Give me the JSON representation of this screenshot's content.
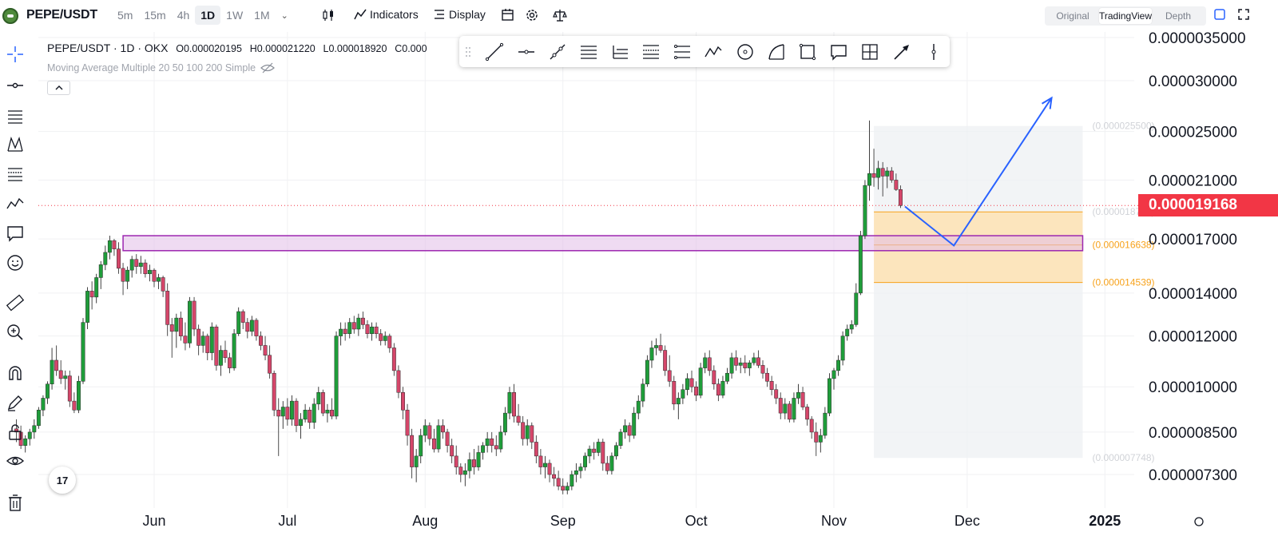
{
  "header": {
    "symbol": "PEPE/USDT",
    "intervals": [
      "5m",
      "15m",
      "4h",
      "1D",
      "1W",
      "1M"
    ],
    "active_interval": "1D",
    "indicators_label": "Indicators",
    "display_label": "Display",
    "view_modes": [
      "Original",
      "TradingView",
      "Depth"
    ],
    "active_view": "TradingView"
  },
  "legend": {
    "pair": "PEPE/USDT · 1D · OKX",
    "open": "O0.000020195",
    "high": "H0.000021220",
    "low": "L0.000018920",
    "close": "C0.000",
    "ma_label": "Moving Average Multiple 20 50 100 200 Simple"
  },
  "last_price": "0.000019168",
  "tv_logo": "17",
  "colors": {
    "up": "#26a69a",
    "up_candle": "#1f9d3a",
    "down": "#c2185b",
    "down_candle": "#d5466a",
    "last_price_badge": "#f23645",
    "zone_purple": "#9c27b0",
    "fib_orange": "#f7a21b",
    "arrow_blue": "#2962ff"
  },
  "chart_data": {
    "type": "candlestick",
    "y_axis_labels": [
      "0.0000035000",
      "0.000030000",
      "0.000025000",
      "0.000021000",
      "0.000017000",
      "0.000014000",
      "0.000012000",
      "0.000010000",
      "0.000008500",
      "0.000007300"
    ],
    "y_axis_values": [
      3.5e-05,
      3e-05,
      2.5e-05,
      2.1e-05,
      1.7e-05,
      1.4e-05,
      1.2e-05,
      1e-05,
      8.5e-06,
      7.3e-06
    ],
    "x_axis_labels": [
      "Jun",
      "Jul",
      "Aug",
      "Sep",
      "Oct",
      "Nov",
      "Dec",
      "2025"
    ],
    "x_axis_dates": [
      "2024-06-01",
      "2024-07-01",
      "2024-08-01",
      "2024-09-01",
      "2024-10-01",
      "2024-11-01",
      "2024-12-01",
      "2025-01-01"
    ],
    "candles": {
      "start_date": "2024-05-01",
      "interval": "1D",
      "ohlc": [
        [
          8.6,
          8.9,
          8.2,
          8.5
        ],
        [
          8.5,
          8.7,
          8.0,
          8.1
        ],
        [
          8.1,
          8.4,
          7.9,
          8.3
        ],
        [
          8.3,
          8.6,
          8.1,
          8.5
        ],
        [
          8.5,
          8.9,
          8.3,
          8.7
        ],
        [
          8.7,
          9.3,
          8.6,
          9.2
        ],
        [
          9.2,
          9.7,
          9.0,
          9.6
        ],
        [
          9.6,
          10.2,
          9.4,
          10.1
        ],
        [
          10.1,
          11.5,
          9.9,
          11.0
        ],
        [
          11.0,
          11.6,
          10.4,
          10.6
        ],
        [
          10.6,
          11.0,
          10.1,
          10.3
        ],
        [
          10.3,
          10.6,
          9.9,
          10.4
        ],
        [
          10.4,
          10.6,
          9.3,
          9.5
        ],
        [
          9.5,
          9.8,
          9.1,
          9.2
        ],
        [
          9.2,
          10.4,
          9.1,
          10.2
        ],
        [
          10.2,
          12.8,
          10.1,
          12.6
        ],
        [
          12.6,
          14.3,
          12.3,
          14.1
        ],
        [
          14.1,
          14.6,
          13.2,
          13.8
        ],
        [
          13.8,
          15.0,
          13.5,
          14.8
        ],
        [
          14.8,
          15.7,
          14.2,
          15.5
        ],
        [
          15.5,
          16.6,
          15.2,
          16.2
        ],
        [
          16.2,
          17.2,
          15.8,
          16.9
        ],
        [
          16.9,
          17.0,
          16.0,
          16.4
        ],
        [
          16.4,
          16.8,
          15.0,
          15.3
        ],
        [
          15.3,
          15.6,
          13.9,
          14.6
        ],
        [
          14.6,
          15.4,
          14.2,
          15.2
        ],
        [
          15.2,
          16.0,
          14.8,
          15.8
        ],
        [
          15.8,
          16.1,
          15.0,
          15.4
        ],
        [
          15.4,
          16.0,
          15.0,
          15.6
        ],
        [
          15.6,
          15.8,
          14.8,
          15.0
        ],
        [
          15.0,
          15.5,
          14.6,
          15.2
        ],
        [
          15.2,
          15.3,
          14.3,
          14.6
        ],
        [
          14.6,
          15.0,
          14.2,
          14.8
        ],
        [
          14.8,
          14.9,
          13.8,
          14.1
        ],
        [
          14.1,
          14.5,
          12.0,
          12.5
        ],
        [
          12.5,
          12.8,
          11.1,
          12.2
        ],
        [
          12.2,
          13.0,
          11.5,
          12.8
        ],
        [
          12.8,
          13.1,
          11.8,
          12.0
        ],
        [
          12.0,
          12.6,
          11.4,
          11.7
        ],
        [
          11.7,
          13.8,
          11.5,
          13.6
        ],
        [
          13.6,
          13.8,
          12.0,
          12.3
        ],
        [
          12.3,
          12.5,
          11.2,
          11.6
        ],
        [
          11.6,
          12.2,
          11.3,
          12.0
        ],
        [
          12.0,
          12.1,
          11.0,
          11.3
        ],
        [
          11.3,
          12.6,
          11.0,
          12.4
        ],
        [
          12.4,
          12.5,
          10.6,
          10.8
        ],
        [
          10.8,
          11.6,
          10.4,
          11.4
        ],
        [
          11.4,
          11.8,
          10.9,
          11.1
        ],
        [
          11.1,
          11.3,
          10.5,
          10.7
        ],
        [
          10.7,
          12.3,
          10.6,
          12.1
        ],
        [
          12.1,
          13.3,
          12.0,
          13.1
        ],
        [
          13.1,
          13.2,
          12.3,
          12.6
        ],
        [
          12.6,
          12.8,
          11.9,
          12.2
        ],
        [
          12.2,
          12.9,
          12.0,
          12.7
        ],
        [
          12.7,
          12.8,
          11.8,
          12.0
        ],
        [
          12.0,
          12.2,
          11.4,
          11.6
        ],
        [
          11.6,
          12.0,
          11.0,
          11.2
        ],
        [
          11.2,
          11.6,
          10.3,
          10.5
        ],
        [
          10.5,
          10.6,
          9.0,
          9.2
        ],
        [
          9.2,
          9.6,
          7.8,
          9.0
        ],
        [
          9.0,
          9.5,
          8.6,
          9.3
        ],
        [
          9.3,
          9.6,
          8.7,
          8.9
        ],
        [
          8.9,
          9.7,
          8.7,
          9.5
        ],
        [
          9.5,
          9.6,
          8.5,
          8.7
        ],
        [
          8.7,
          9.1,
          8.3,
          8.9
        ],
        [
          8.9,
          9.4,
          8.8,
          9.2
        ],
        [
          9.2,
          9.3,
          8.6,
          8.8
        ],
        [
          8.8,
          9.6,
          8.6,
          9.4
        ],
        [
          9.4,
          10.0,
          9.2,
          9.8
        ],
        [
          9.8,
          9.9,
          9.0,
          9.1
        ],
        [
          9.1,
          9.4,
          8.8,
          9.2
        ],
        [
          9.2,
          9.6,
          8.9,
          9.0
        ],
        [
          9.0,
          12.2,
          8.9,
          12.0
        ],
        [
          12.0,
          12.6,
          11.6,
          12.3
        ],
        [
          12.3,
          12.6,
          11.8,
          12.1
        ],
        [
          12.1,
          12.8,
          11.9,
          12.6
        ],
        [
          12.6,
          12.9,
          12.1,
          12.3
        ],
        [
          12.3,
          13.0,
          12.0,
          12.8
        ],
        [
          12.8,
          13.1,
          12.3,
          12.5
        ],
        [
          12.5,
          12.7,
          11.9,
          12.1
        ],
        [
          12.1,
          12.6,
          11.8,
          12.4
        ],
        [
          12.4,
          12.6,
          11.9,
          12.1
        ],
        [
          12.1,
          12.3,
          11.6,
          11.8
        ],
        [
          11.8,
          12.2,
          11.6,
          12.0
        ],
        [
          12.0,
          12.1,
          11.3,
          11.5
        ],
        [
          11.5,
          11.7,
          10.4,
          10.6
        ],
        [
          10.6,
          10.8,
          9.6,
          9.8
        ],
        [
          9.8,
          10.0,
          8.9,
          9.2
        ],
        [
          9.2,
          9.4,
          8.1,
          8.4
        ],
        [
          8.4,
          8.6,
          7.2,
          7.5
        ],
        [
          7.5,
          8.0,
          7.1,
          7.8
        ],
        [
          7.8,
          8.6,
          7.6,
          8.4
        ],
        [
          8.4,
          8.9,
          8.2,
          8.7
        ],
        [
          8.7,
          8.8,
          8.1,
          8.3
        ],
        [
          8.3,
          8.6,
          7.9,
          8.0
        ],
        [
          8.0,
          8.9,
          7.9,
          8.7
        ],
        [
          8.7,
          8.9,
          8.3,
          8.5
        ],
        [
          8.5,
          8.6,
          7.9,
          8.1
        ],
        [
          8.1,
          8.3,
          7.6,
          7.8
        ],
        [
          7.8,
          8.1,
          7.3,
          7.5
        ],
        [
          7.5,
          7.6,
          7.1,
          7.3
        ],
        [
          7.3,
          7.6,
          7.0,
          7.4
        ],
        [
          7.4,
          7.9,
          7.2,
          7.7
        ],
        [
          7.7,
          8.0,
          7.3,
          7.5
        ],
        [
          7.5,
          8.1,
          7.4,
          7.9
        ],
        [
          7.9,
          8.2,
          7.7,
          8.1
        ],
        [
          8.1,
          8.5,
          7.9,
          8.3
        ],
        [
          8.3,
          8.5,
          7.9,
          8.1
        ],
        [
          8.1,
          8.4,
          7.8,
          8.0
        ],
        [
          8.0,
          8.7,
          7.9,
          8.5
        ],
        [
          8.5,
          9.3,
          8.4,
          9.1
        ],
        [
          9.1,
          10.0,
          8.9,
          9.8
        ],
        [
          9.8,
          10.1,
          8.8,
          9.0
        ],
        [
          9.0,
          9.4,
          8.7,
          8.8
        ],
        [
          8.8,
          9.0,
          8.1,
          8.3
        ],
        [
          8.3,
          8.9,
          8.1,
          8.7
        ],
        [
          8.7,
          8.8,
          8.0,
          8.2
        ],
        [
          8.2,
          8.4,
          7.6,
          7.8
        ],
        [
          7.8,
          8.0,
          7.3,
          7.5
        ],
        [
          7.5,
          7.8,
          7.2,
          7.6
        ],
        [
          7.6,
          7.7,
          7.1,
          7.3
        ],
        [
          7.3,
          7.5,
          7.0,
          7.2
        ],
        [
          7.2,
          7.4,
          6.9,
          7.0
        ],
        [
          7.0,
          7.2,
          6.8,
          6.9
        ],
        [
          6.9,
          7.1,
          6.8,
          7.0
        ],
        [
          7.0,
          7.4,
          6.9,
          7.3
        ],
        [
          7.3,
          7.6,
          7.1,
          7.4
        ],
        [
          7.4,
          7.6,
          7.2,
          7.5
        ],
        [
          7.5,
          7.9,
          7.4,
          7.8
        ],
        [
          7.8,
          8.1,
          7.6,
          8.0
        ],
        [
          8.0,
          8.2,
          7.7,
          7.9
        ],
        [
          7.9,
          8.3,
          7.8,
          8.2
        ],
        [
          8.2,
          8.3,
          7.4,
          7.6
        ],
        [
          7.6,
          7.8,
          7.3,
          7.4
        ],
        [
          7.4,
          7.9,
          7.3,
          7.8
        ],
        [
          7.8,
          8.2,
          7.7,
          8.1
        ],
        [
          8.1,
          8.6,
          8.0,
          8.5
        ],
        [
          8.5,
          8.9,
          8.3,
          8.7
        ],
        [
          8.7,
          8.8,
          8.2,
          8.4
        ],
        [
          8.4,
          9.3,
          8.3,
          9.1
        ],
        [
          9.1,
          9.7,
          8.9,
          9.5
        ],
        [
          9.5,
          10.3,
          9.3,
          10.1
        ],
        [
          10.1,
          11.2,
          10.0,
          11.0
        ],
        [
          11.0,
          11.8,
          10.7,
          11.5
        ],
        [
          11.5,
          11.9,
          11.2,
          11.6
        ],
        [
          11.6,
          12.1,
          11.3,
          11.4
        ],
        [
          11.4,
          11.6,
          10.4,
          10.6
        ],
        [
          10.6,
          11.2,
          10.0,
          10.2
        ],
        [
          10.2,
          10.4,
          9.2,
          9.4
        ],
        [
          9.4,
          9.8,
          8.9,
          9.6
        ],
        [
          9.6,
          10.1,
          9.4,
          9.9
        ],
        [
          9.9,
          10.5,
          9.7,
          10.3
        ],
        [
          10.3,
          10.6,
          9.8,
          10.0
        ],
        [
          10.0,
          10.2,
          9.5,
          9.7
        ],
        [
          9.7,
          10.9,
          9.6,
          10.7
        ],
        [
          10.7,
          11.3,
          10.5,
          11.1
        ],
        [
          11.1,
          11.4,
          10.4,
          10.6
        ],
        [
          10.6,
          10.8,
          9.9,
          10.1
        ],
        [
          10.1,
          10.3,
          9.5,
          9.7
        ],
        [
          9.7,
          10.4,
          9.6,
          10.2
        ],
        [
          10.2,
          10.7,
          10.1,
          10.5
        ],
        [
          10.5,
          11.3,
          10.3,
          11.1
        ],
        [
          11.1,
          11.4,
          10.6,
          10.8
        ],
        [
          10.8,
          11.1,
          10.5,
          10.9
        ],
        [
          10.9,
          11.2,
          10.5,
          10.7
        ],
        [
          10.7,
          11.0,
          10.4,
          10.9
        ],
        [
          10.9,
          11.3,
          10.8,
          11.1
        ],
        [
          11.1,
          11.4,
          10.7,
          10.8
        ],
        [
          10.8,
          11.0,
          10.3,
          10.5
        ],
        [
          10.5,
          10.7,
          10.0,
          10.2
        ],
        [
          10.2,
          10.4,
          9.7,
          9.9
        ],
        [
          9.9,
          10.1,
          9.4,
          9.6
        ],
        [
          9.6,
          9.8,
          8.9,
          9.1
        ],
        [
          9.1,
          9.6,
          8.9,
          9.4
        ],
        [
          9.4,
          9.5,
          8.8,
          8.9
        ],
        [
          8.9,
          9.8,
          8.8,
          9.6
        ],
        [
          9.6,
          10.1,
          9.4,
          9.8
        ],
        [
          9.8,
          10.0,
          9.2,
          9.3
        ],
        [
          9.3,
          9.4,
          8.7,
          8.9
        ],
        [
          8.9,
          9.0,
          8.3,
          8.5
        ],
        [
          8.5,
          8.8,
          7.8,
          8.2
        ],
        [
          8.2,
          8.6,
          7.9,
          8.4
        ],
        [
          8.4,
          9.3,
          8.3,
          9.1
        ],
        [
          9.1,
          10.5,
          9.0,
          10.3
        ],
        [
          10.3,
          10.7,
          9.9,
          10.6
        ],
        [
          10.6,
          11.2,
          10.4,
          11.0
        ],
        [
          11.0,
          12.2,
          10.8,
          12.0
        ],
        [
          12.0,
          12.5,
          11.8,
          12.3
        ],
        [
          12.3,
          12.7,
          12.1,
          12.5
        ],
        [
          12.5,
          14.5,
          12.4,
          14.0
        ],
        [
          14.0,
          17.5,
          13.9,
          17.2
        ],
        [
          17.2,
          21.0,
          17.0,
          20.6
        ],
        [
          20.6,
          26.0,
          19.5,
          21.5
        ],
        [
          21.5,
          23.5,
          20.5,
          21.2
        ],
        [
          21.2,
          22.5,
          20.3,
          21.9
        ],
        [
          21.9,
          22.4,
          19.8,
          21.3
        ],
        [
          21.3,
          22.0,
          20.4,
          21.7
        ],
        [
          21.7,
          22.0,
          20.8,
          21.0
        ],
        [
          21.0,
          21.5,
          20.2,
          20.3
        ],
        [
          20.3,
          20.6,
          19.0,
          19.17
        ]
      ],
      "note": "OHLC values in units of 1e-6 USDT"
    },
    "zones": [
      {
        "type": "rectangle",
        "name": "resistance",
        "top": 1.72e-05,
        "bottom": 1.63e-05,
        "color": "#9c27b0"
      }
    ],
    "fib": {
      "levels": [
        {
          "label": "(0.000025500)",
          "value": 2.55e-05
        },
        {
          "label": "(0.000018736)",
          "value": 1.8736e-05
        },
        {
          "label": "(0.000016638)",
          "value": 1.6638e-05
        },
        {
          "label": "(0.000014539)",
          "value": 1.4539e-05
        },
        {
          "label": "(0.000007748)",
          "value": 7.748e-06
        }
      ]
    },
    "last_price_value": 1.9168e-05,
    "projection_path": [
      {
        "date": "2024-11-17",
        "value": 1.91e-05
      },
      {
        "date": "2024-11-28",
        "value": 1.66e-05
      },
      {
        "date": "2024-12-20",
        "value": 2.82e-05
      }
    ]
  }
}
